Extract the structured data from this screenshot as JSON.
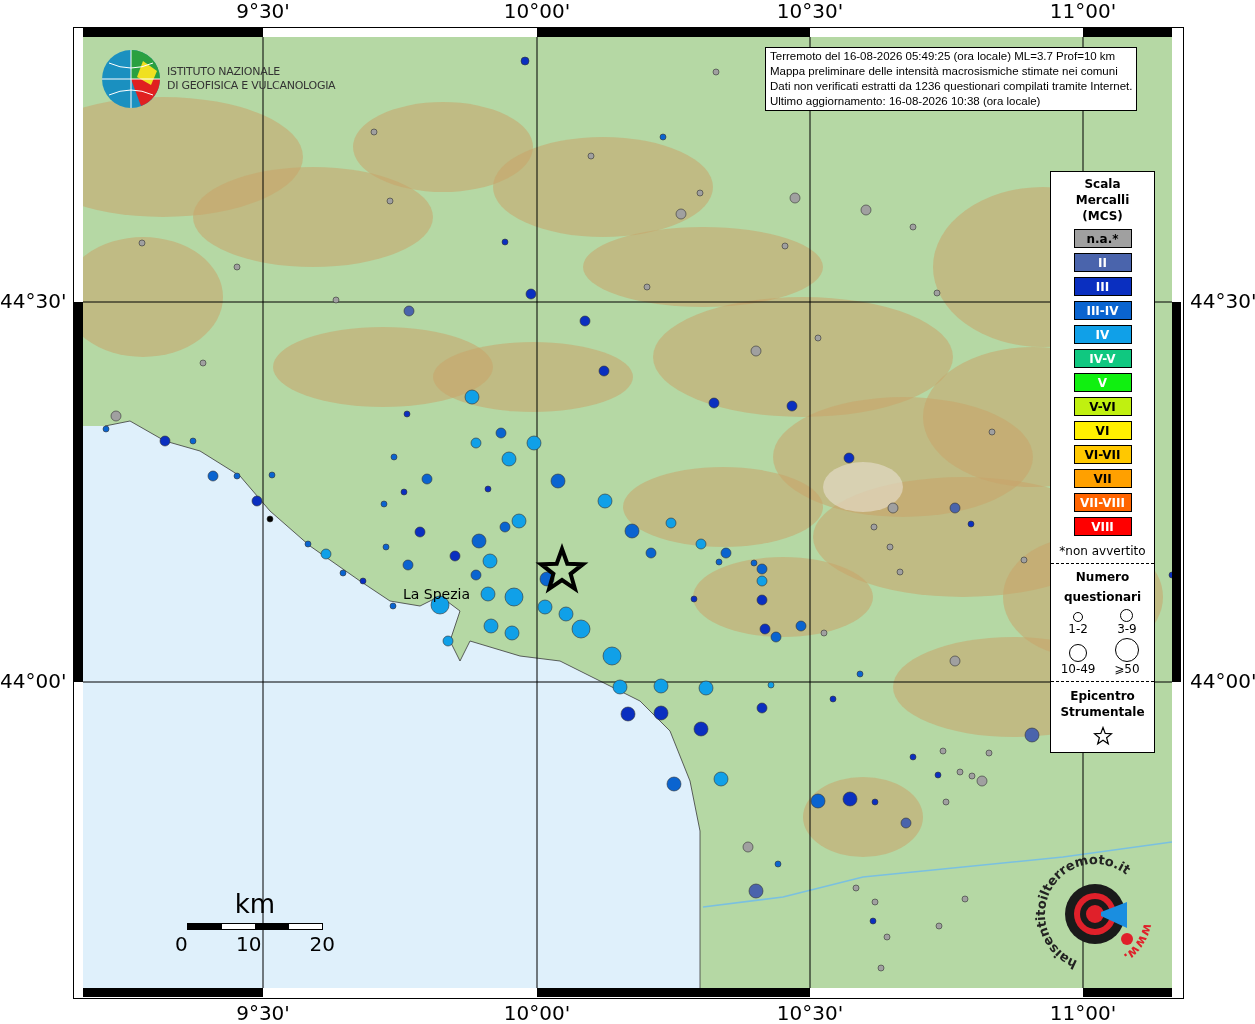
{
  "header": {
    "lines": [
      "Terremoto del 16-08-2026 05:49:25 (ora locale) ML=3.7 Prof=10 km",
      "Mappa preliminare delle intensità macrosismiche stimate nei comuni",
      "Dati non verificati estratti da 1236 questionari compilati tramite Internet.",
      "Ultimo aggiornamento: 16-08-2026 10:38 (ora locale)"
    ]
  },
  "logo": {
    "lines": [
      "ISTITUTO NAZIONALE",
      "DI GEOFISICA E VULCANOLOGIA"
    ]
  },
  "longitude_labels_top": [
    "9°30'",
    "10°00'",
    "10°30'",
    "11°00'"
  ],
  "longitude_labels_bottom": [
    "9°30'",
    "10°00'",
    "10°30'",
    "11°00'"
  ],
  "latitude_labels_left": [
    "44°30'",
    "44°00'"
  ],
  "latitude_labels_right": [
    "44°30'",
    "44°00'"
  ],
  "place_label": "La Spezia",
  "scale_bar": {
    "unit": "km",
    "ticks": [
      "0",
      "10",
      "20"
    ]
  },
  "legend": {
    "title_lines": [
      "Scala",
      "Mercalli",
      "(MCS)"
    ],
    "levels": [
      {
        "label": "n.a.*",
        "color": "#a0a0a0"
      },
      {
        "label": "II",
        "color": "#4a64ac"
      },
      {
        "label": "III",
        "color": "#0a2fc0"
      },
      {
        "label": "III-IV",
        "color": "#0a64d0"
      },
      {
        "label": "IV",
        "color": "#10a0e8"
      },
      {
        "label": "IV-V",
        "color": "#10c880"
      },
      {
        "label": "V",
        "color": "#10f010"
      },
      {
        "label": "V-VI",
        "color": "#c0f010"
      },
      {
        "label": "VI",
        "color": "#fff000"
      },
      {
        "label": "VI-VII",
        "color": "#ffc800"
      },
      {
        "label": "VII",
        "color": "#ffa000"
      },
      {
        "label": "VII-VIII",
        "color": "#ff6400"
      },
      {
        "label": "VIII",
        "color": "#ff0000"
      }
    ],
    "footnote": "*non avvertito",
    "count_title_lines": [
      "Numero",
      "questionari"
    ],
    "counts": [
      "1-2",
      "3-9",
      "10-49",
      "⩾50"
    ],
    "epicenter_title_lines": [
      "Epicentro",
      "Strumentale"
    ]
  },
  "hsit_logo": {
    "text": "haisentitoilterremoto.it",
    "prefix": "www."
  }
}
